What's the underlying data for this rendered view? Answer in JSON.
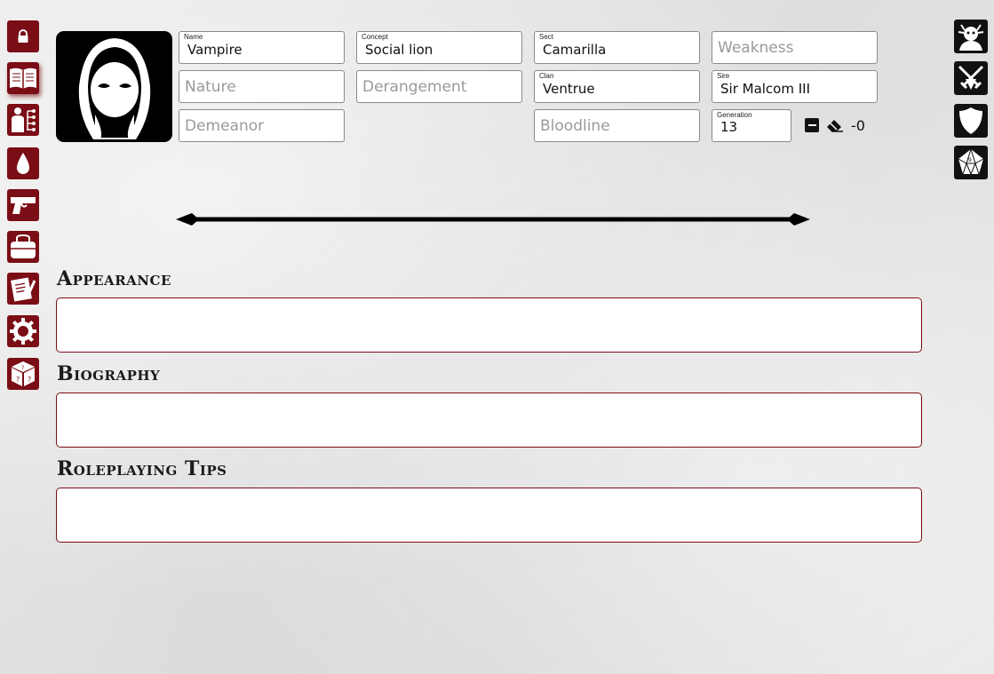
{
  "nav_left": [
    {
      "name": "lock-icon",
      "active": false
    },
    {
      "name": "book-icon",
      "active": true
    },
    {
      "name": "character-tree-icon",
      "active": false
    },
    {
      "name": "blood-drop-icon",
      "active": false
    },
    {
      "name": "pistol-icon",
      "active": false
    },
    {
      "name": "bag-icon",
      "active": false
    },
    {
      "name": "notes-icon",
      "active": false
    },
    {
      "name": "gear-icon",
      "active": false
    },
    {
      "name": "dice-icon",
      "active": false
    }
  ],
  "nav_right": [
    {
      "name": "monster-icon"
    },
    {
      "name": "crossed-swords-icon"
    },
    {
      "name": "shield-icon"
    },
    {
      "name": "d10-dice-icon"
    }
  ],
  "fields": {
    "name": {
      "label": "Name",
      "value": "Vampire"
    },
    "concept": {
      "label": "Concept",
      "value": "Social lion"
    },
    "sect": {
      "label": "Sect",
      "value": "Camarilla"
    },
    "weakness": {
      "placeholder": "Weakness"
    },
    "nature": {
      "placeholder": "Nature"
    },
    "derangement": {
      "placeholder": "Derangement"
    },
    "clan": {
      "label": "Clan",
      "value": "Ventrue"
    },
    "sire": {
      "label": "Sire",
      "value": "Sir Malcom III"
    },
    "demeanor": {
      "placeholder": "Demeanor"
    },
    "bloodline": {
      "placeholder": "Bloodline"
    },
    "generation": {
      "label": "Generation",
      "value": "13"
    }
  },
  "generation_modifier": "-0",
  "sections": {
    "appearance": {
      "title": "Appearance",
      "value": ""
    },
    "biography": {
      "title": "Biography",
      "value": ""
    },
    "roleplaying_tips": {
      "title": "Roleplaying Tips",
      "value": ""
    }
  },
  "colors": {
    "accent": "#7a0d15",
    "dark": "#111111",
    "background": "#e4e4e4"
  }
}
